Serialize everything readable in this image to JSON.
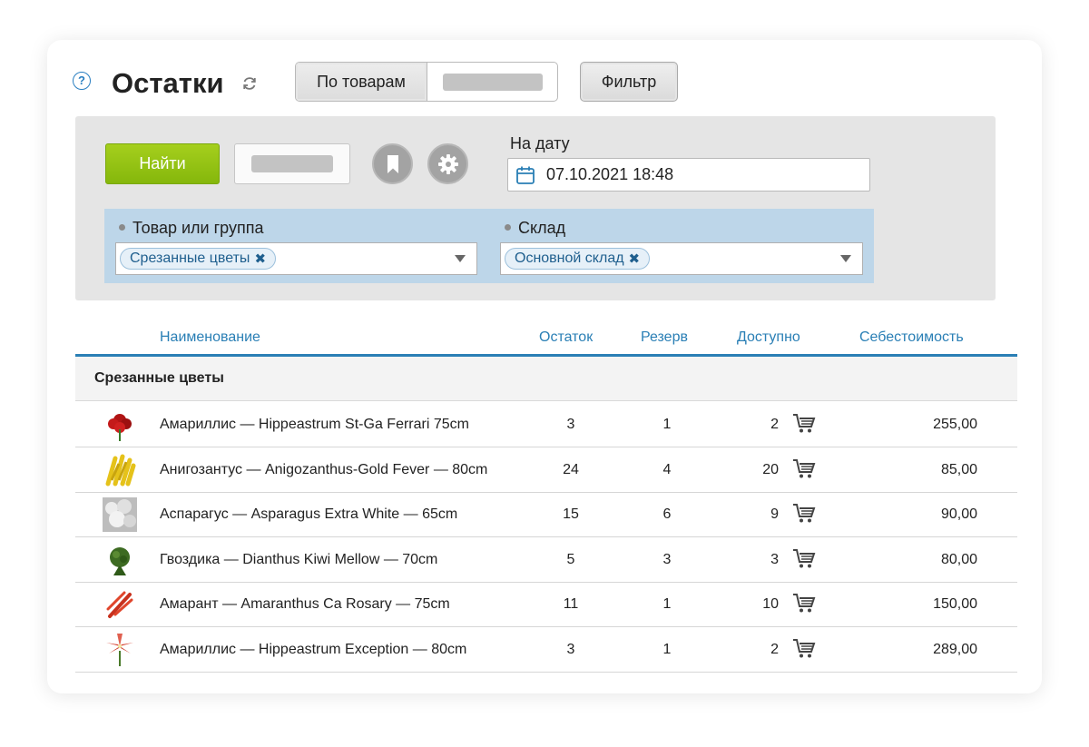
{
  "header": {
    "title": "Остатки",
    "help_icon_glyph": "?",
    "segment_tab_products": "По товарам",
    "filter_button": "Фильтр"
  },
  "search_panel": {
    "find_button": "Найти",
    "date_label": "На дату",
    "date_value": "07.10.2021 18:48",
    "product_filter": {
      "label": "Товар или группа",
      "tag": "Срезанные цветы",
      "tag_remove_glyph": "✖"
    },
    "warehouse_filter": {
      "label": "Склад",
      "tag": "Основной склад",
      "tag_remove_glyph": "✖"
    }
  },
  "table": {
    "columns": {
      "name": "Наименование",
      "stock": "Остаток",
      "reserve": "Резерв",
      "available": "Доступно",
      "cost": "Себестоимость"
    },
    "group_title": "Срезанные цветы",
    "rows": [
      {
        "name": "Амариллис — Hippeastrum St-Ga Ferrari 75cm",
        "stock": "3",
        "reserve": "1",
        "available": "2",
        "cost": "255,00",
        "icon": "red-amaryllis-thumb"
      },
      {
        "name": "Анигозантус — Anigozanthus-Gold Fever — 80cm",
        "stock": "24",
        "reserve": "4",
        "available": "20",
        "cost": "85,00",
        "icon": "yellow-anigozanthus-thumb"
      },
      {
        "name": "Аспарагус —  Asparagus Extra White — 65cm",
        "stock": "15",
        "reserve": "6",
        "available": "9",
        "cost": "90,00",
        "icon": "white-asparagus-thumb"
      },
      {
        "name": "Гвоздика — Dianthus Kiwi Mellow — 70cm",
        "stock": "5",
        "reserve": "3",
        "available": "3",
        "cost": "80,00",
        "icon": "green-dianthus-thumb"
      },
      {
        "name": "Амарант — Amaranthus Ca Rosary — 75cm",
        "stock": "11",
        "reserve": "1",
        "available": "10",
        "cost": "150,00",
        "icon": "red-amaranthus-thumb"
      },
      {
        "name": "Амариллис — Hippeastrum Exception — 80cm",
        "stock": "3",
        "reserve": "1",
        "available": "2",
        "cost": "289,00",
        "icon": "striped-amaryllis-thumb"
      }
    ]
  },
  "colors": {
    "accent_blue": "#2a7fb5",
    "find_green": "#95c414",
    "filters_bg": "#bdd6e9",
    "panel_bg": "#e5e5e5"
  }
}
